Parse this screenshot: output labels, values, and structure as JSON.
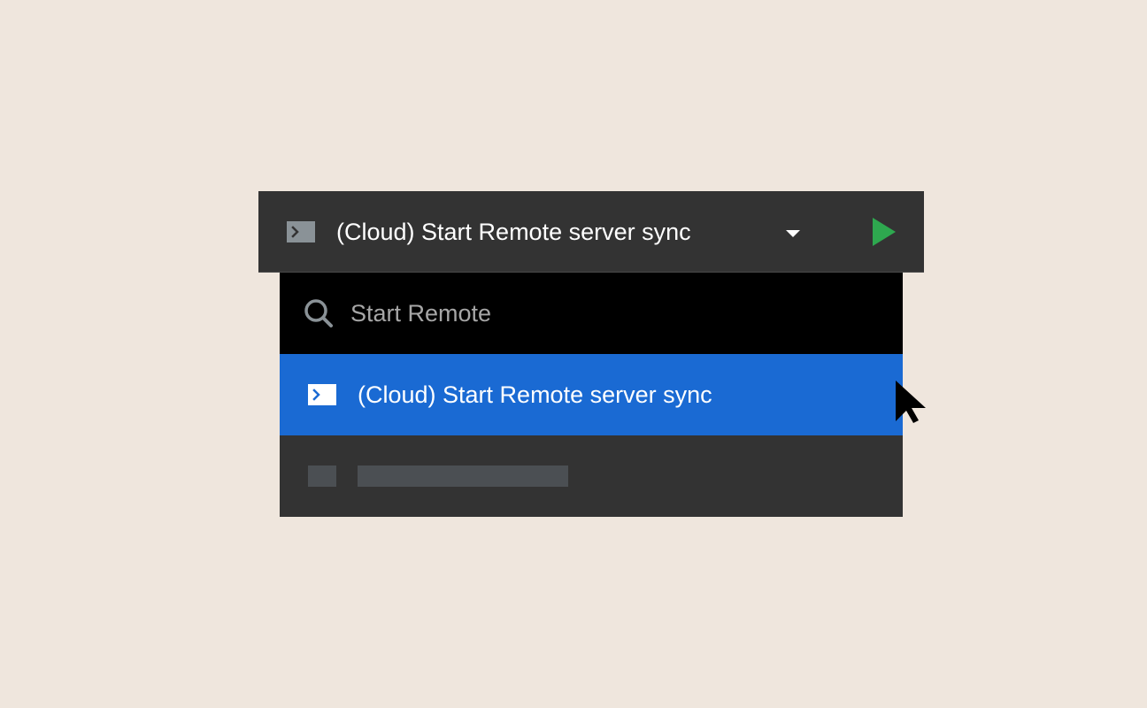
{
  "run_bar": {
    "config_label": "(Cloud) Start Remote server sync",
    "config_icon": "terminal-icon",
    "dropdown_icon": "caret-down-icon",
    "run_icon": "play-icon",
    "run_color": "#2ea84f"
  },
  "search": {
    "value": "Start Remote",
    "icon": "search-icon"
  },
  "results": [
    {
      "label": "(Cloud) Start Remote server sync",
      "icon": "terminal-icon",
      "selected": true
    }
  ],
  "colors": {
    "background": "#efe6dd",
    "bar": "#333333",
    "search_bg": "#000000",
    "selection": "#1a6ad3"
  }
}
